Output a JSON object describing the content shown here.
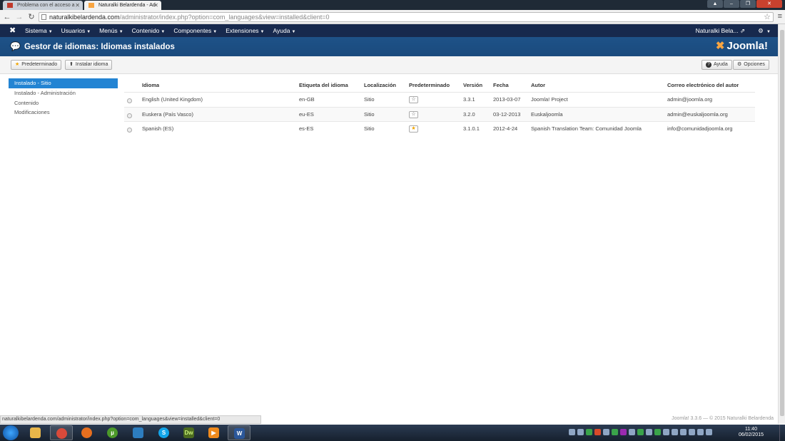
{
  "browser": {
    "tabs": [
      {
        "title": "Problema con el acceso a",
        "active": false
      },
      {
        "title": "Naturalki Belardenda - Ad",
        "active": true
      }
    ],
    "url_host": "naturalkibelardenda.com",
    "url_path": "/administrator/index.php?option=com_languages&view=installed&client=0",
    "status_url": "naturalkibelardenda.com/administrator/index.php?option=com_languages&view=installed&client=0"
  },
  "navbar": {
    "items": [
      {
        "label": "Sistema"
      },
      {
        "label": "Usuarios"
      },
      {
        "label": "Menús"
      },
      {
        "label": "Contenido"
      },
      {
        "label": "Componentes"
      },
      {
        "label": "Extensiones"
      },
      {
        "label": "Ayuda"
      }
    ],
    "user": "Naturalki Bela..."
  },
  "header": {
    "title": "Gestor de idiomas: Idiomas instalados",
    "brand": "Joomla!"
  },
  "toolbar": {
    "default_label": "Predeterminado",
    "install_label": "Instalar idioma",
    "help_label": "Ayuda",
    "options_label": "Opciones"
  },
  "sidebar": {
    "items": [
      {
        "label": "Instalado - Sitio",
        "active": true
      },
      {
        "label": "Instalado - Administración",
        "active": false
      },
      {
        "label": "Contenido",
        "active": false
      },
      {
        "label": "Modificaciones",
        "active": false
      }
    ]
  },
  "table": {
    "columns": [
      "Idioma",
      "Etiqueta del idioma",
      "Localización",
      "Predeterminado",
      "Versión",
      "Fecha",
      "Autor",
      "Correo electrónico del autor"
    ],
    "rows": [
      {
        "language": "English (United Kingdom)",
        "tag": "en-GB",
        "location": "Sitio",
        "default": false,
        "version": "3.3.1",
        "date": "2013-03-07",
        "author": "Joomla! Project",
        "email": "admin@joomla.org"
      },
      {
        "language": "Euskera (País Vasco)",
        "tag": "eu-ES",
        "location": "Sitio",
        "default": false,
        "version": "3.2.0",
        "date": "03-12-2013",
        "author": "Euskaljoomla",
        "email": "admin@euskaljoomla.org"
      },
      {
        "language": "Spanish (ES)",
        "tag": "es-ES",
        "location": "Sitio",
        "default": true,
        "version": "3.1.0.1",
        "date": "2012-4-24",
        "author": "Spanish Translation Team: Comunidad Joomla",
        "email": "info@comunidadjoomla.org"
      }
    ]
  },
  "footer": {
    "note": "Joomla! 3.3.6 — © 2015 Naturalki Belardenda"
  },
  "taskbar": {
    "time": "11:40",
    "date": "06/02/2015"
  },
  "colors": {
    "navbar": "#17294d",
    "header": "#1a4a7d",
    "sidebar_active": "#2384d3",
    "star": "#f0a400"
  }
}
